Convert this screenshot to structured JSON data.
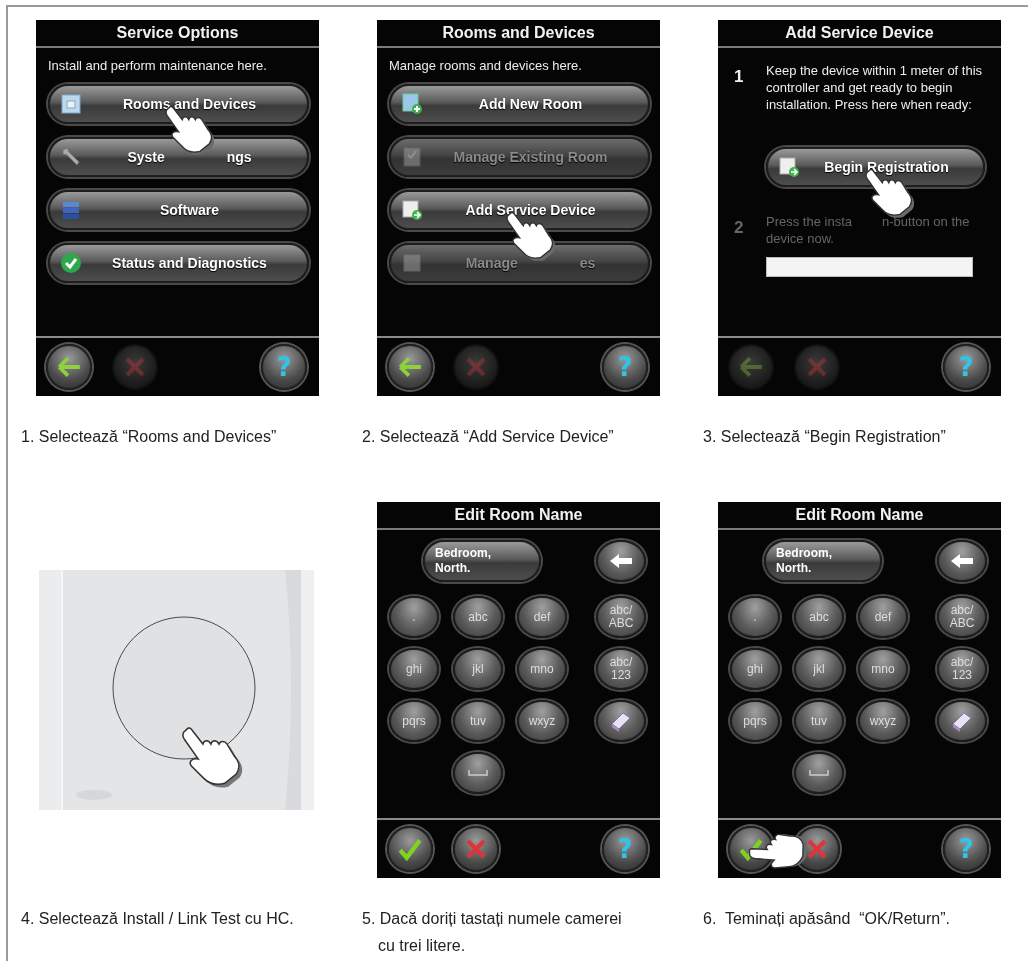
{
  "panels": [
    {
      "kind": "menu",
      "title": "Service Options",
      "subtitle": "Install and perform maintenance here.",
      "buttons": [
        {
          "kind": "room",
          "label_parts": [
            "Rooms and Devices"
          ],
          "disabled": false,
          "touched": true
        },
        {
          "kind": "wrench",
          "label_parts": [
            "Syste",
            "ngs"
          ],
          "disabled": false,
          "touched": false
        },
        {
          "kind": "stack",
          "label_parts": [
            "Software"
          ],
          "disabled": false,
          "touched": false
        },
        {
          "kind": "check",
          "label_parts": [
            "Status and Diagnostics"
          ],
          "disabled": false,
          "touched": false
        }
      ],
      "footer": {
        "kind": "nav",
        "left_disabled": false,
        "cancel_disabled": true,
        "help": "?"
      },
      "caption": "1. Selectează “Rooms and Devices”"
    },
    {
      "kind": "menu",
      "title": "Rooms and Devices",
      "subtitle": "Manage rooms and devices here.",
      "buttons": [
        {
          "kind": "add-room",
          "label_parts": [
            "Add New Room"
          ],
          "disabled": false,
          "touched": false
        },
        {
          "kind": "manage-room",
          "label_parts": [
            "Manage Existing Room"
          ],
          "disabled": true,
          "touched": false
        },
        {
          "kind": "device-add",
          "label_parts": [
            "Add Service Device"
          ],
          "disabled": false,
          "touched": true
        },
        {
          "kind": "device",
          "label_parts": [
            "Manage",
            "es"
          ],
          "disabled": true,
          "touched": false
        }
      ],
      "footer": {
        "kind": "nav",
        "left_disabled": false,
        "cancel_disabled": true,
        "help": "?"
      },
      "caption": "2. Selectează “Add Service Device”"
    },
    {
      "kind": "steps",
      "title": "Add Service Device",
      "steps": [
        {
          "number": "1",
          "text_parts": [
            "Keep the device within 1 meter of this controller and get ready to begin installation. Press here when ready:"
          ],
          "dimmed": false,
          "button": {
            "kind": "device-add",
            "label_parts": [
              "Begin Registration"
            ],
            "disabled": false,
            "touched": true
          }
        },
        {
          "number": "2",
          "text_parts": [
            "Press the insta",
            "n-button on the device now."
          ],
          "dimmed": true
        }
      ],
      "footer": {
        "kind": "nav",
        "left_disabled": true,
        "cancel_disabled": true,
        "help": "?"
      },
      "caption": "3. Selectează “Begin Registration”"
    },
    {
      "kind": "picture",
      "caption": "4. Selectează Install / Link Test cu HC."
    },
    {
      "kind": "keyboard",
      "title": "Edit Room Name",
      "field_lines": [
        "Bedroom,",
        "North."
      ],
      "keys": [
        {
          "kind": "text",
          "lines": [
            "."
          ]
        },
        {
          "kind": "text",
          "lines": [
            "abc"
          ]
        },
        {
          "kind": "text",
          "lines": [
            "def"
          ]
        },
        {
          "kind": "text",
          "lines": [
            "abc/",
            "ABC"
          ]
        },
        {
          "kind": "text",
          "lines": [
            "ghi"
          ]
        },
        {
          "kind": "text",
          "lines": [
            "jkl"
          ]
        },
        {
          "kind": "text",
          "lines": [
            "mno"
          ]
        },
        {
          "kind": "text",
          "lines": [
            "abc/",
            "123"
          ]
        },
        {
          "kind": "text",
          "lines": [
            "pqrs"
          ]
        },
        {
          "kind": "text",
          "lines": [
            "tuv"
          ]
        },
        {
          "kind": "text",
          "lines": [
            "wxyz"
          ]
        },
        {
          "kind": "keyboard"
        },
        {
          "kind": "space"
        }
      ],
      "footer": {
        "kind": "confirm",
        "left_disabled": false,
        "cancel_disabled": false,
        "help": "?"
      },
      "caption": "5. Dacă doriți tastați numele camerei cu trei litere."
    },
    {
      "kind": "keyboard",
      "title": "Edit Room Name",
      "field_lines": [
        "Bedroom,",
        "North."
      ],
      "keys": [
        {
          "kind": "text",
          "lines": [
            "."
          ]
        },
        {
          "kind": "text",
          "lines": [
            "abc"
          ]
        },
        {
          "kind": "text",
          "lines": [
            "def"
          ]
        },
        {
          "kind": "text",
          "lines": [
            "abc/",
            "ABC"
          ]
        },
        {
          "kind": "text",
          "lines": [
            "ghi"
          ]
        },
        {
          "kind": "text",
          "lines": [
            "jkl"
          ]
        },
        {
          "kind": "text",
          "lines": [
            "mno"
          ]
        },
        {
          "kind": "text",
          "lines": [
            "abc/",
            "123"
          ]
        },
        {
          "kind": "text",
          "lines": [
            "pqrs"
          ]
        },
        {
          "kind": "text",
          "lines": [
            "tuv"
          ]
        },
        {
          "kind": "text",
          "lines": [
            "wxyz"
          ]
        },
        {
          "kind": "keyboard"
        },
        {
          "kind": "space"
        }
      ],
      "footer": {
        "kind": "confirm",
        "left_disabled": false,
        "cancel_disabled": false,
        "touched": true,
        "help": "?"
      },
      "caption": "6.  Teminați apăsând  “OK/Return”."
    }
  ]
}
